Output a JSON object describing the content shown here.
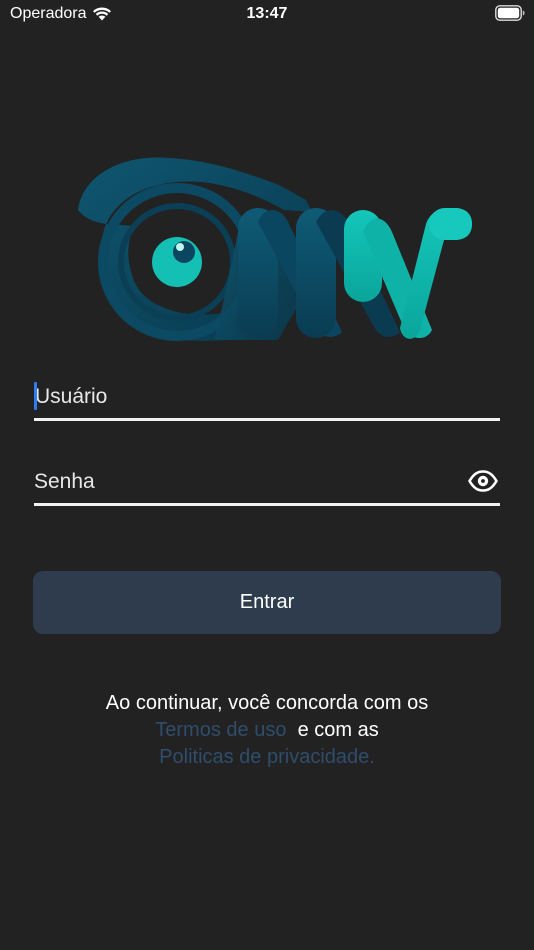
{
  "status_bar": {
    "carrier": "Operadora",
    "time": "13:47"
  },
  "login": {
    "username_placeholder": "Usuário",
    "password_placeholder": "Senha",
    "submit_label": "Entrar"
  },
  "terms": {
    "line1": "Ao continuar, você concorda com os",
    "terms_link": "Termos de uso",
    "connector": "e com as",
    "privacy_link": "Politicas de privacidade."
  },
  "icons": {
    "wifi": "wifi-icon",
    "battery": "battery-icon",
    "logo": "mw-logo",
    "password_toggle": "eye-icon"
  },
  "colors": {
    "background": "#222222",
    "button": "#2e3c4e",
    "link": "#2f4d6c",
    "logo_dark": "#0d4b66",
    "logo_teal": "#11b8ad",
    "caret": "#2f7cf6"
  }
}
